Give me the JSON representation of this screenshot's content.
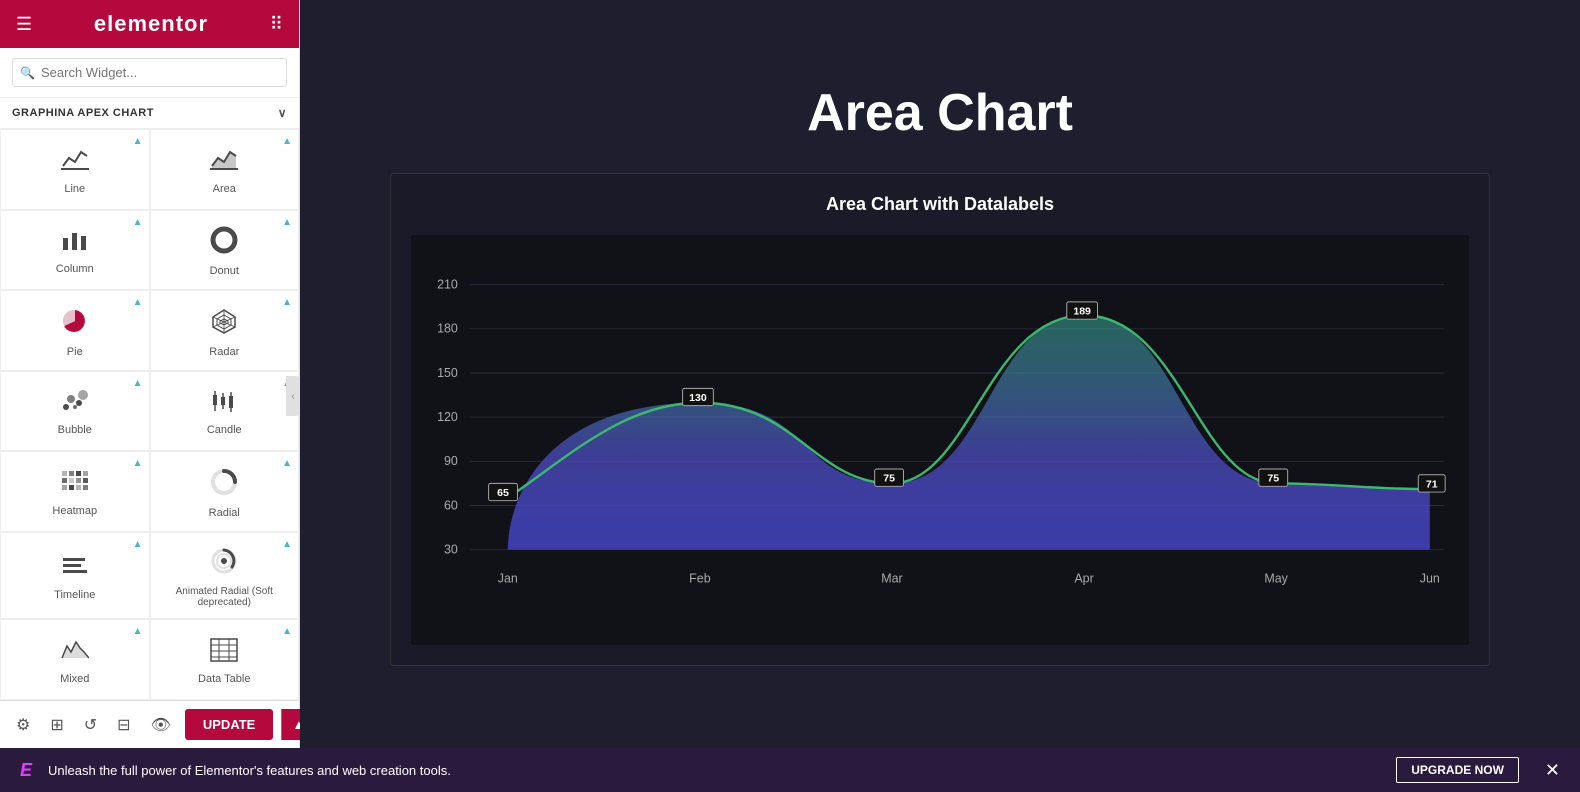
{
  "header": {
    "hamburger": "☰",
    "logo": "elementor",
    "grid_icon": "⠿"
  },
  "search": {
    "placeholder": "Search Widget..."
  },
  "section": {
    "label": "GRAPHINA APEX CHART",
    "chevron": "∨"
  },
  "widgets": [
    {
      "id": "line",
      "label": "Line",
      "icon": "line",
      "pro": true
    },
    {
      "id": "area",
      "label": "Area",
      "icon": "area",
      "pro": true
    },
    {
      "id": "column",
      "label": "Column",
      "icon": "column",
      "pro": true
    },
    {
      "id": "donut",
      "label": "Donut",
      "icon": "donut",
      "pro": true
    },
    {
      "id": "pie",
      "label": "Pie",
      "icon": "pie",
      "pro": true
    },
    {
      "id": "radar",
      "label": "Radar",
      "icon": "radar",
      "pro": true
    },
    {
      "id": "bubble",
      "label": "Bubble",
      "icon": "bubble",
      "pro": true
    },
    {
      "id": "candle",
      "label": "Candle",
      "icon": "candle",
      "pro": true
    },
    {
      "id": "heatmap",
      "label": "Heatmap",
      "icon": "heatmap",
      "pro": true
    },
    {
      "id": "radial",
      "label": "Radial",
      "icon": "radial",
      "pro": true
    },
    {
      "id": "timeline",
      "label": "Timeline",
      "icon": "timeline",
      "pro": true
    },
    {
      "id": "animated-radial",
      "label": "Animated Radial (Soft deprecated)",
      "icon": "animated-radial",
      "pro": true
    },
    {
      "id": "mixed",
      "label": "Mixed",
      "icon": "mixed",
      "pro": true
    },
    {
      "id": "data-table",
      "label": "Data Table",
      "icon": "data-table",
      "pro": true
    }
  ],
  "toolbar": {
    "update_label": "UPDATE",
    "update_dropdown": "▲"
  },
  "page": {
    "title": "Area Chart"
  },
  "chart": {
    "title": "Area Chart with Datalabels",
    "y_labels": [
      "210",
      "180",
      "150",
      "120",
      "90",
      "60",
      "30"
    ],
    "x_labels": [
      "Jan",
      "Feb",
      "Mar",
      "Apr",
      "May",
      "Jun"
    ],
    "data_points": [
      {
        "month": "Jan",
        "value": 65
      },
      {
        "month": "Feb",
        "value": 130
      },
      {
        "month": "Mar",
        "value": 75
      },
      {
        "month": "Apr",
        "value": 189
      },
      {
        "month": "May",
        "value": 75
      },
      {
        "month": "Jun",
        "value": 71
      }
    ]
  },
  "notification": {
    "icon": "E",
    "text": "Unleash the full power of Elementor's features and web creation tools.",
    "upgrade_label": "UPGRADE NOW",
    "close": "✕"
  }
}
